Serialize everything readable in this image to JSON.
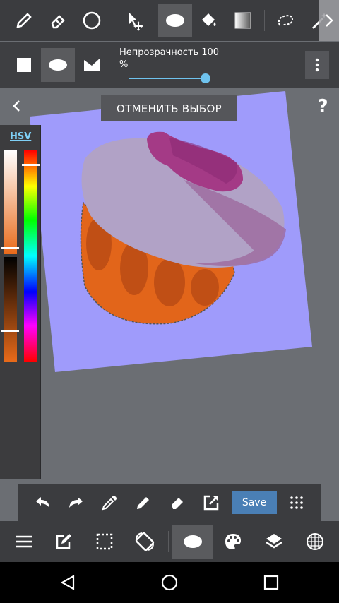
{
  "toolbar_top": {
    "tools": [
      "pen-tool",
      "eraser-tool",
      "circle-tool",
      "move-tool",
      "ellipse-select-tool",
      "fill-tool",
      "gradient-tool",
      "lasso-tool",
      "magic-wand-tool"
    ],
    "selected": "ellipse-select-tool"
  },
  "options_bar": {
    "shapes": [
      "rectangle",
      "ellipse",
      "polygon"
    ],
    "selected_shape": "ellipse",
    "opacity_label": "Непрозрачность 100",
    "opacity_unit": "%",
    "opacity_value": 100
  },
  "canvas": {
    "deselect_label": "ОТМЕНИТЬ ВЫБОР",
    "help_label": "?",
    "back_label": "‹"
  },
  "color_panel": {
    "mode_label": "HSV",
    "accent": "#e86a1a"
  },
  "bottom_toolbar": {
    "save_label": "Save",
    "save_color": "#4a7fb5"
  },
  "bottom_menu": {
    "selected": "ellipse-select"
  }
}
